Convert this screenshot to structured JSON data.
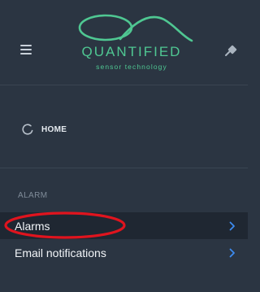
{
  "logo": {
    "name": "QUANTIFIED",
    "tagline": "sensor technology",
    "color": "#4fc792"
  },
  "icons": {
    "menu": "hamburger-icon",
    "pin": "pin-icon",
    "home": "home-circle-icon",
    "chevron": "chevron-right-icon"
  },
  "nav": {
    "home_label": "HOME",
    "section_label": "ALARM",
    "items": [
      {
        "label": "Alarms",
        "active": true
      },
      {
        "label": "Email notifications",
        "active": false
      }
    ]
  },
  "colors": {
    "background": "#2b3542",
    "active_row": "#1f2732",
    "chevron": "#3d8bf0",
    "annotation": "#e0141e"
  }
}
